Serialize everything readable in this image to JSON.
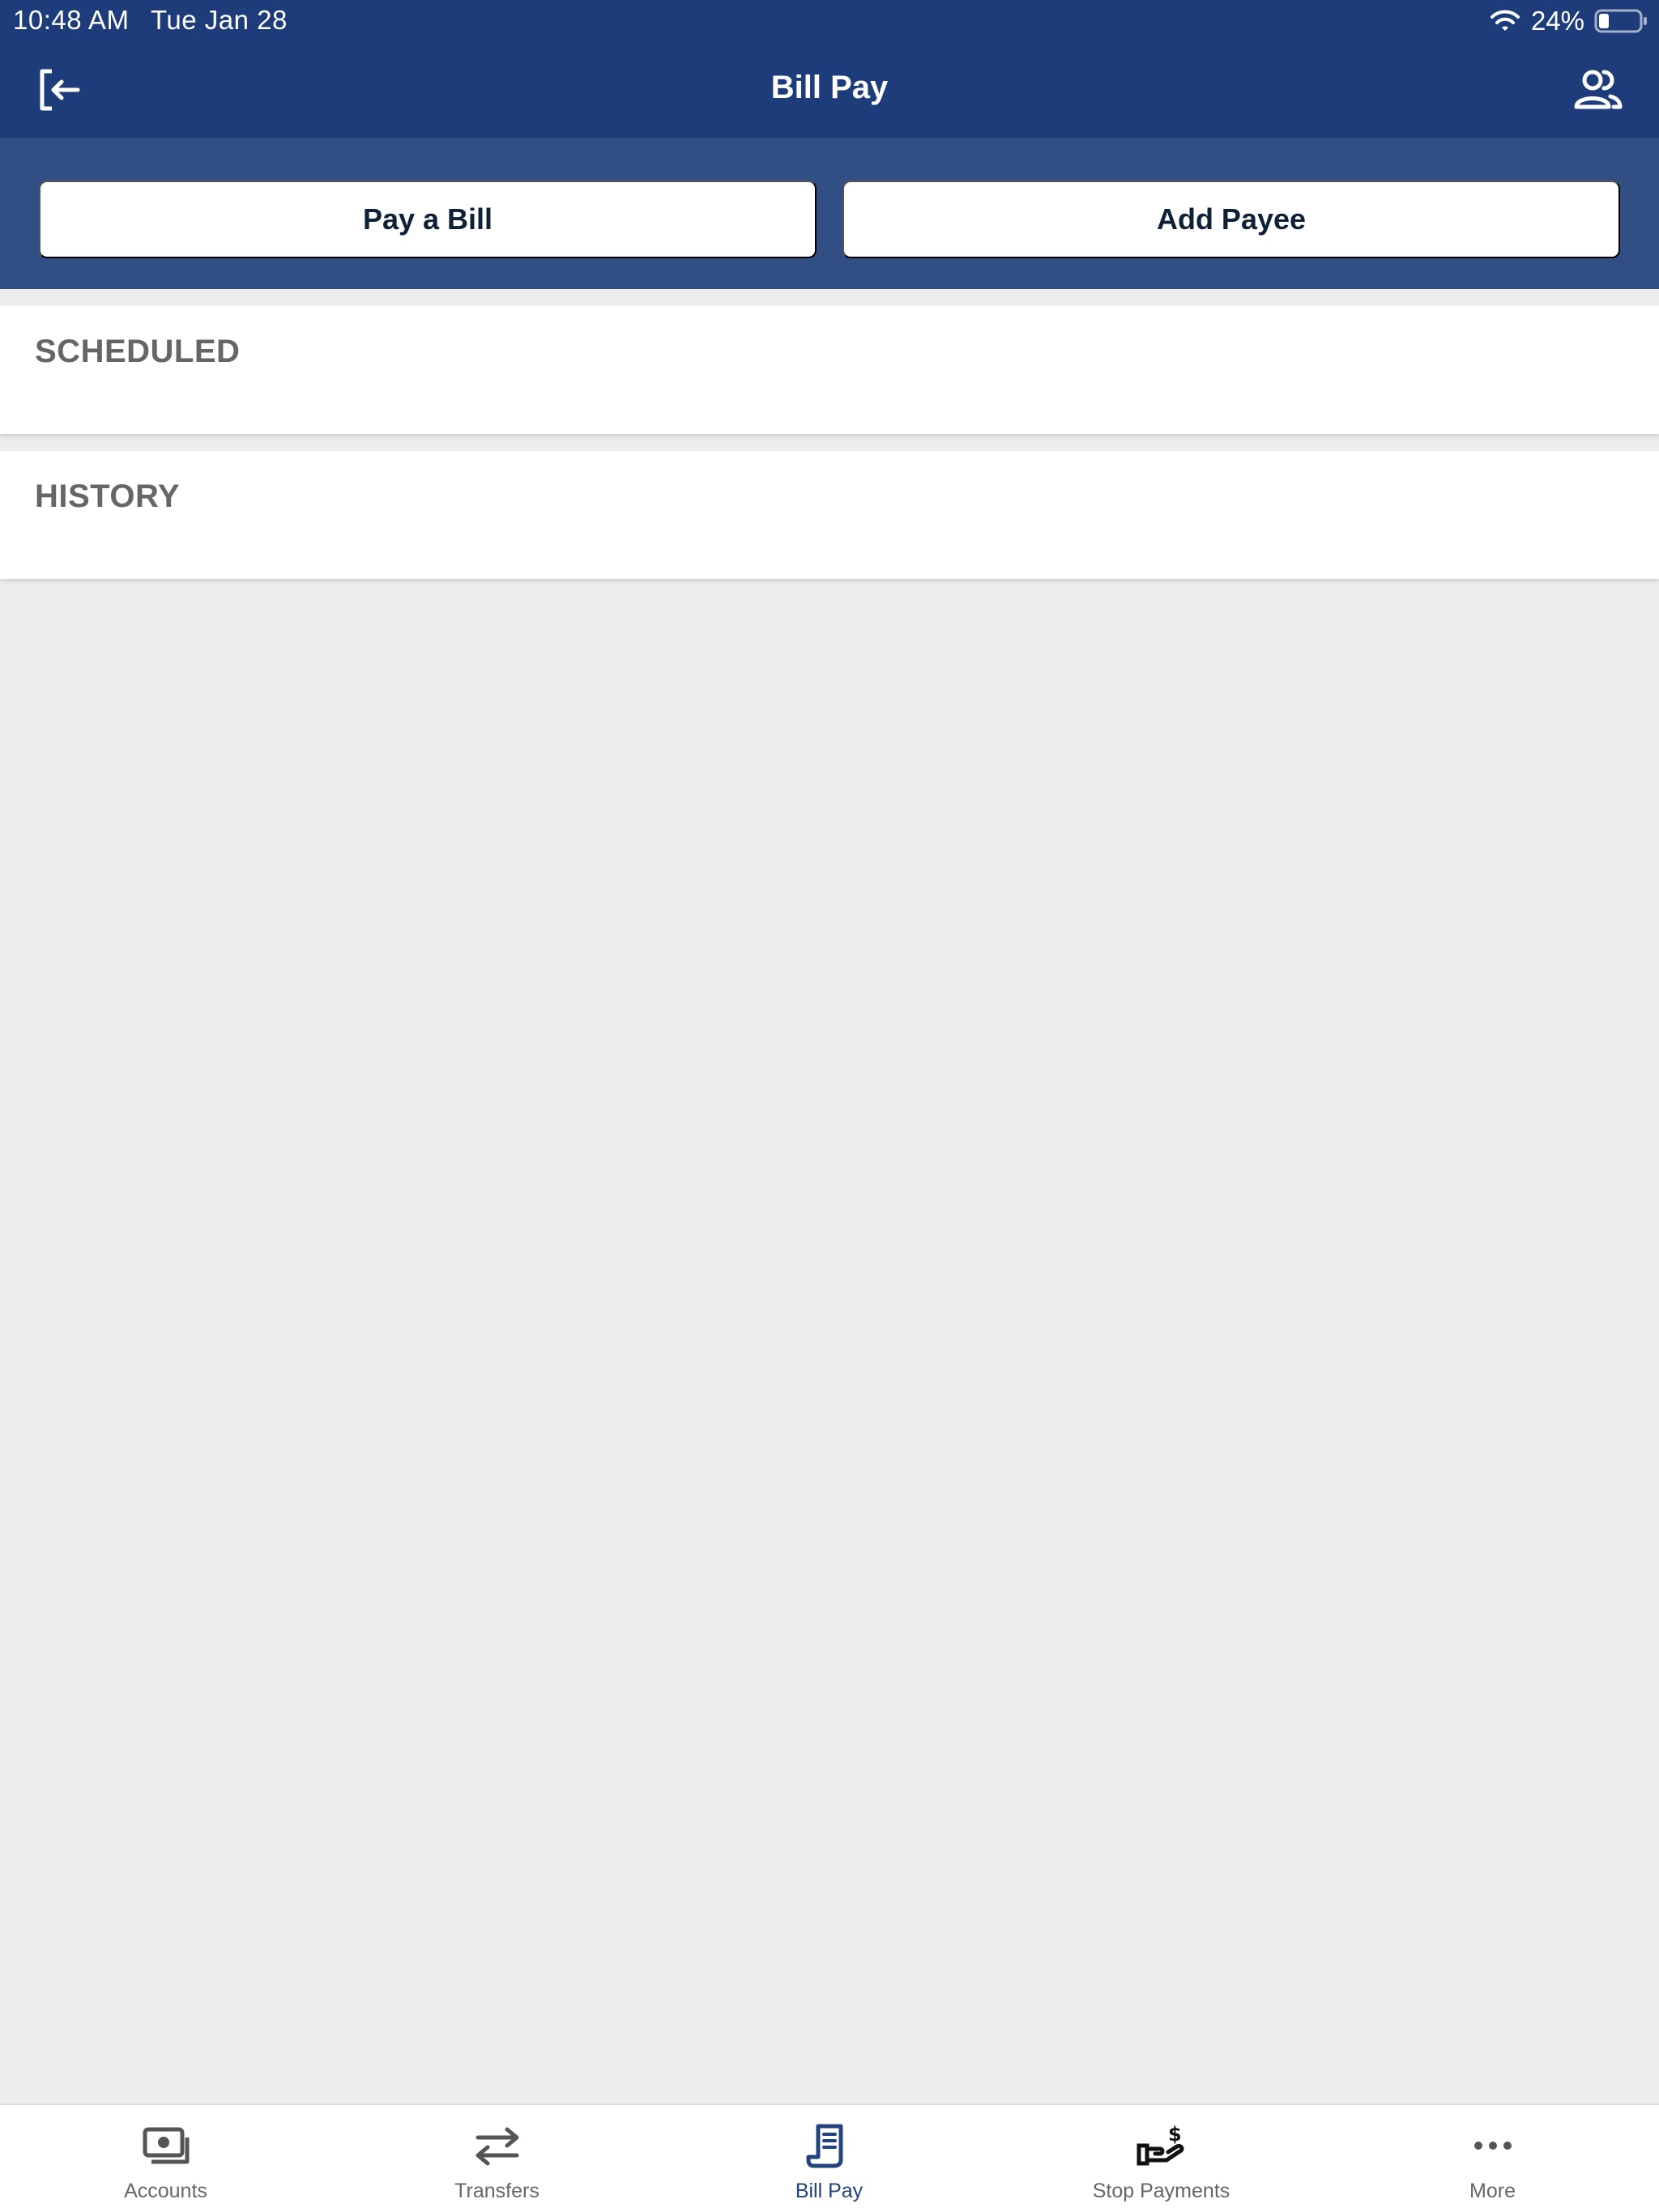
{
  "status_bar": {
    "time": "10:48 AM",
    "date": "Tue Jan 28",
    "battery_percent": "24%",
    "battery_level": 0.24,
    "icons": [
      "wifi-icon",
      "battery-icon"
    ]
  },
  "nav": {
    "title": "Bill Pay",
    "left_icon": "logout-icon",
    "right_icon": "user-group-icon"
  },
  "actions": {
    "pay_bill": "Pay a Bill",
    "add_payee": "Add Payee"
  },
  "sections": {
    "scheduled": "SCHEDULED",
    "history": "HISTORY"
  },
  "tabs": [
    {
      "label": "Accounts",
      "icon": "cash-icon",
      "active": false
    },
    {
      "label": "Transfers",
      "icon": "transfer-arrows-icon",
      "active": false
    },
    {
      "label": "Bill Pay",
      "icon": "bill-icon",
      "active": true
    },
    {
      "label": "Stop Payments",
      "icon": "hand-money-icon",
      "active": false
    },
    {
      "label": "More",
      "icon": "more-dots-icon",
      "active": false
    }
  ],
  "colors": {
    "nav_bg": "#1f3c7a",
    "action_strip_bg": "#324f85",
    "active_tab": "#23427e",
    "inactive_tab": "#666666",
    "page_bg": "#ededed"
  }
}
